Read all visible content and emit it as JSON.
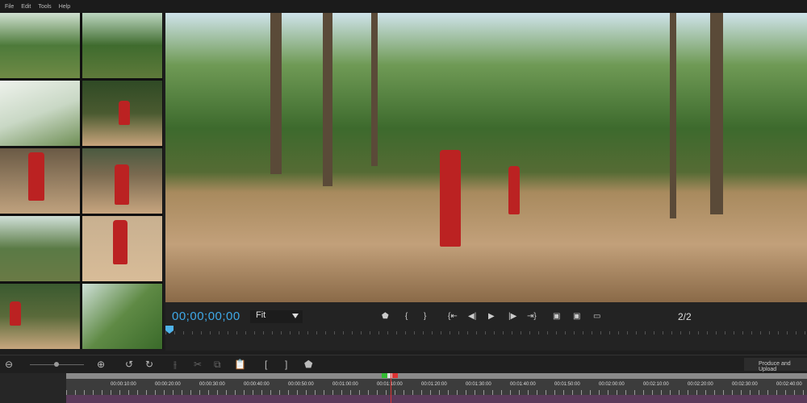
{
  "menu": [
    "File",
    "Edit",
    "Tools",
    "Help"
  ],
  "player": {
    "timecode": "00;00;00;00",
    "zoom_select": "Fit",
    "page": "2/2"
  },
  "toolbar": {
    "produce_label": "Produce and Upload"
  },
  "ruler": {
    "ticks": [
      "00:00:10:00",
      "00:00:20:00",
      "00:00:30:00",
      "00:00:40:00",
      "00:00:50:00",
      "00:01:00:00",
      "00:01:10:00",
      "00:01:20:00",
      "00:01:30:00",
      "00:01:40:00",
      "00:01:50:00",
      "00:02:00:00",
      "00:02:10:00",
      "00:02:20:00",
      "00:02:30:00",
      "00:02:40:00"
    ]
  }
}
